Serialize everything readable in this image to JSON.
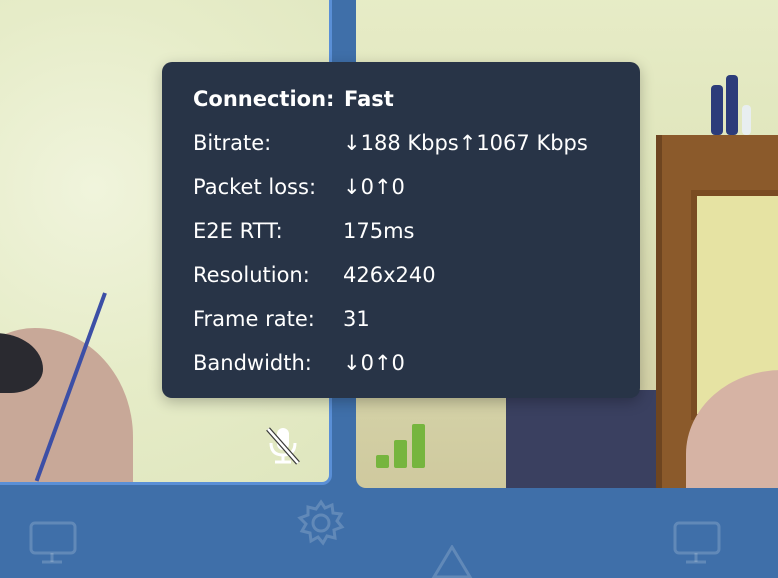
{
  "stats": {
    "connection_label": "Connection:",
    "connection_value": "Fast",
    "rows": [
      {
        "label": "Bitrate:",
        "value": "↓188 Kbps↑1067 Kbps"
      },
      {
        "label": "Packet loss:",
        "value": "↓0↑0"
      },
      {
        "label": "E2E RTT:",
        "value": "175ms"
      },
      {
        "label": "Resolution:",
        "value": "426x240"
      },
      {
        "label": "Frame rate:",
        "value": "31"
      },
      {
        "label": "Bandwidth:",
        "value": "↓0↑0"
      }
    ]
  },
  "indicators": {
    "mic_icon": "microphone-muted-icon",
    "signal_icon": "signal-bars-icon",
    "signal_level": 1.0,
    "signal_color": "#76b53e"
  },
  "toolbar": {
    "icons": [
      "desktop-icon",
      "gear-icon",
      "send-icon",
      "desktop-icon"
    ]
  },
  "colors": {
    "background": "#3f6fa9",
    "popover": "#283447",
    "tile_border_active": "#5a8fd6"
  }
}
